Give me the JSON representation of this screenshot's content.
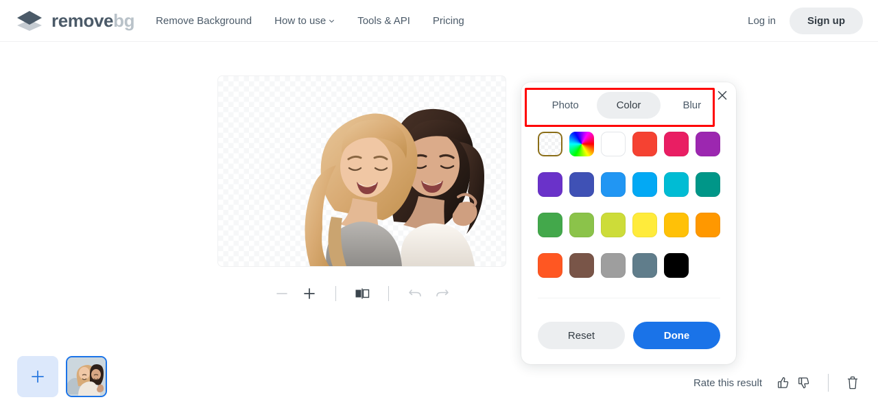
{
  "header": {
    "logo": {
      "icon": "layers-logo-icon",
      "text_primary": "remove",
      "text_secondary": "bg"
    },
    "nav": [
      {
        "label": "Remove Background",
        "has_caret": false
      },
      {
        "label": "How to use",
        "has_caret": true
      },
      {
        "label": "Tools & API",
        "has_caret": false
      },
      {
        "label": "Pricing",
        "has_caret": false
      }
    ],
    "login_label": "Log in",
    "signup_label": "Sign up"
  },
  "canvas": {
    "alt": "Two laughing women, background removed, transparent checkerboard"
  },
  "image_toolbar": {
    "zoom_out": "−",
    "zoom_in": "+",
    "compare_icon": "compare-icon",
    "undo_icon": "undo-icon",
    "redo_icon": "redo-icon"
  },
  "panel": {
    "tabs": [
      {
        "label": "Photo",
        "active": false
      },
      {
        "label": "Color",
        "active": true
      },
      {
        "label": "Blur",
        "active": false
      }
    ],
    "close_icon": "close-icon",
    "annotation_color": "#ff0000",
    "selected_swatch_border": "#8a6d17",
    "swatches": [
      {
        "name": "transparent",
        "type": "transparent",
        "color": "",
        "selected": true
      },
      {
        "name": "custom-color-picker",
        "type": "wheel",
        "color": "",
        "selected": false
      },
      {
        "name": "white",
        "type": "plain",
        "color": "#ffffff",
        "selected": false
      },
      {
        "name": "red",
        "type": "plain",
        "color": "#f54232",
        "selected": false
      },
      {
        "name": "pink",
        "type": "plain",
        "color": "#e91e63",
        "selected": false
      },
      {
        "name": "purple",
        "type": "plain",
        "color": "#9c27b0",
        "selected": false
      },
      {
        "name": "violet",
        "type": "plain",
        "color": "#6a32c9",
        "selected": false
      },
      {
        "name": "indigo",
        "type": "plain",
        "color": "#3f51b5",
        "selected": false
      },
      {
        "name": "blue",
        "type": "plain",
        "color": "#2196f3",
        "selected": false
      },
      {
        "name": "light-blue",
        "type": "plain",
        "color": "#03a9f4",
        "selected": false
      },
      {
        "name": "cyan",
        "type": "plain",
        "color": "#00bcd4",
        "selected": false
      },
      {
        "name": "teal",
        "type": "plain",
        "color": "#009688",
        "selected": false
      },
      {
        "name": "green",
        "type": "plain",
        "color": "#43a84b",
        "selected": false
      },
      {
        "name": "light-green",
        "type": "plain",
        "color": "#8bc34a",
        "selected": false
      },
      {
        "name": "lime",
        "type": "plain",
        "color": "#cddc39",
        "selected": false
      },
      {
        "name": "yellow",
        "type": "plain",
        "color": "#ffeb3b",
        "selected": false
      },
      {
        "name": "amber",
        "type": "plain",
        "color": "#ffc107",
        "selected": false
      },
      {
        "name": "orange",
        "type": "plain",
        "color": "#ff9800",
        "selected": false
      },
      {
        "name": "deep-orange",
        "type": "plain",
        "color": "#ff5722",
        "selected": false
      },
      {
        "name": "brown",
        "type": "plain",
        "color": "#795548",
        "selected": false
      },
      {
        "name": "grey",
        "type": "plain",
        "color": "#9e9e9e",
        "selected": false
      },
      {
        "name": "blue-grey",
        "type": "plain",
        "color": "#607d8b",
        "selected": false
      },
      {
        "name": "black",
        "type": "plain",
        "color": "#000000",
        "selected": false
      }
    ],
    "reset_label": "Reset",
    "done_label": "Done",
    "done_color": "#1a73e8"
  },
  "bottom": {
    "add_label": "+",
    "add_icon": "plus-icon",
    "thumbnail_name": "image-thumbnail",
    "rate_label": "Rate this result",
    "thumb_up_icon": "thumbs-up-icon",
    "thumb_down_icon": "thumbs-down-icon",
    "delete_icon": "trash-icon"
  }
}
